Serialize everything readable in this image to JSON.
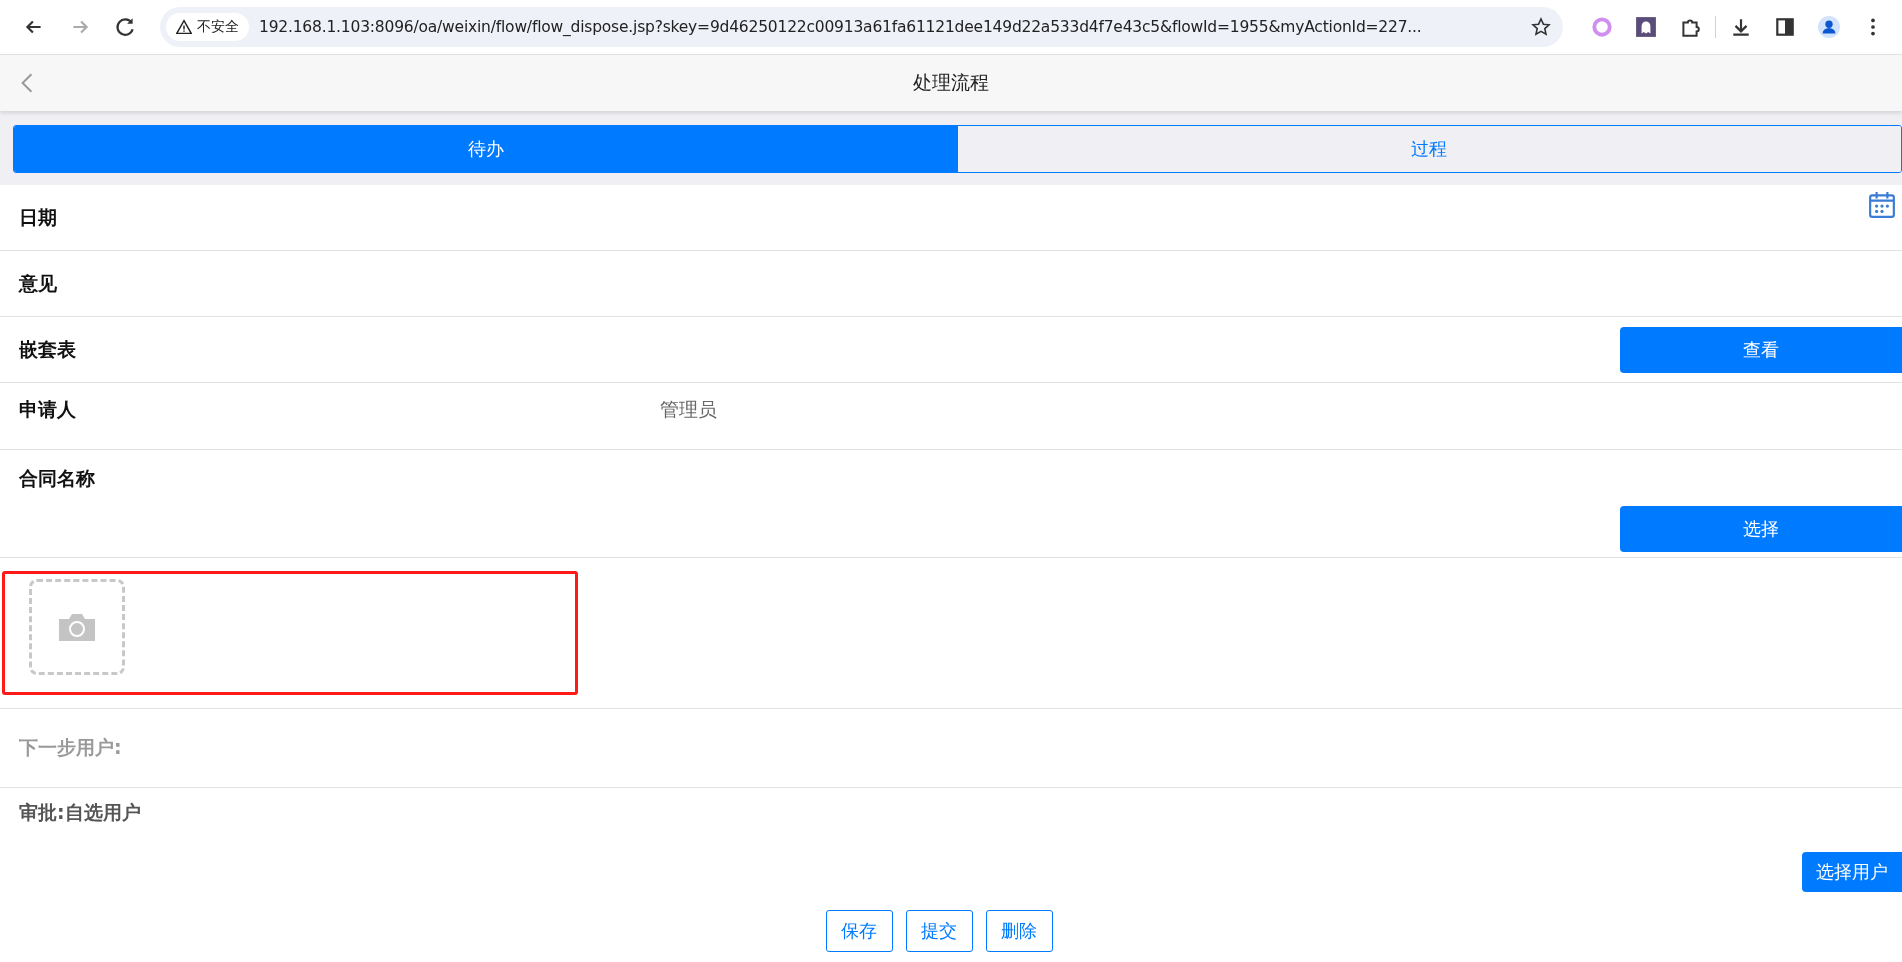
{
  "browser": {
    "security": "不安全",
    "url": "192.168.1.103:8096/oa/weixin/flow/flow_dispose.jsp?skey=9d46250122c00913a61fa61121dee149d22a533d4f7e43c5&flowId=1955&myActionId=227..."
  },
  "header": {
    "title": "处理流程"
  },
  "tabs": [
    {
      "label": "待办",
      "selected": true
    },
    {
      "label": "过程",
      "selected": false
    }
  ],
  "fields": [
    {
      "kind": "date",
      "label": "日期"
    },
    {
      "kind": "text",
      "label": "意见"
    },
    {
      "kind": "button",
      "label": "嵌套表",
      "button": "查看"
    },
    {
      "kind": "value",
      "label": "申请人",
      "value": "管理员"
    },
    {
      "kind": "select",
      "label": "合同名称",
      "button": "选择"
    },
    {
      "kind": "photo"
    }
  ],
  "next_user": {
    "label": "下一步用户:"
  },
  "approval": {
    "label": "审批:自选用户",
    "button": "选择用户"
  },
  "actions": [
    "保存",
    "提交",
    "删除"
  ]
}
